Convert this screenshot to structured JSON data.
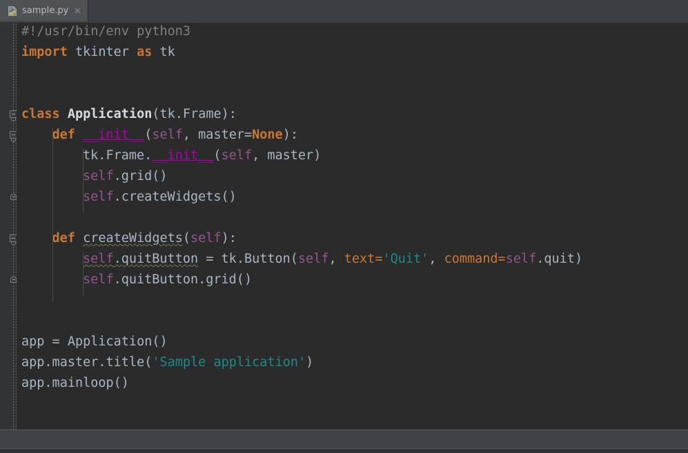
{
  "window": {
    "app_kind": "code-editor",
    "theme": "darcula"
  },
  "tabbar": {
    "tabs": [
      {
        "label": "sample.py",
        "icon": "python-file-icon",
        "close_icon": "close-icon",
        "active": true
      }
    ]
  },
  "editor": {
    "language": "python",
    "colors": {
      "background": "#2b2b2b",
      "gutter": "#313335",
      "default_text": "#a9b7c6",
      "keyword": "#cc7832",
      "comment": "#808080",
      "string": "#1a8c8c",
      "self": "#94558d",
      "magic_method": "#b200b2",
      "class_name": "#d7dbe0",
      "warning_squiggle": "#7a7a52",
      "tab_active": "#4e5254",
      "tab_bar": "#3c3f41",
      "bottom_panel": "#3c4245"
    },
    "lines": [
      {
        "n": 1,
        "indent": 0,
        "tokens": [
          {
            "t": "#!/usr/bin/env python3",
            "c": "comment"
          }
        ]
      },
      {
        "n": 2,
        "indent": 0,
        "tokens": [
          {
            "t": "import",
            "c": "kw"
          },
          {
            "t": " tkinter ",
            "c": "plain"
          },
          {
            "t": "as",
            "c": "kw"
          },
          {
            "t": " tk",
            "c": "plain"
          }
        ]
      },
      {
        "n": 3,
        "indent": 0,
        "tokens": []
      },
      {
        "n": 4,
        "indent": 0,
        "tokens": []
      },
      {
        "n": 5,
        "indent": 0,
        "tokens": [
          {
            "t": "class",
            "c": "kw"
          },
          {
            "t": " ",
            "c": "plain"
          },
          {
            "t": "Application",
            "c": "cls"
          },
          {
            "t": "(tk.Frame):",
            "c": "plain"
          }
        ]
      },
      {
        "n": 6,
        "indent": 1,
        "tokens": [
          {
            "t": "def",
            "c": "kw"
          },
          {
            "t": " ",
            "c": "plain"
          },
          {
            "t": "__init__",
            "c": "magic"
          },
          {
            "t": "(",
            "c": "plain"
          },
          {
            "t": "self",
            "c": "self"
          },
          {
            "t": ", master=",
            "c": "plain"
          },
          {
            "t": "None",
            "c": "kw"
          },
          {
            "t": "):",
            "c": "plain"
          }
        ]
      },
      {
        "n": 7,
        "indent": 2,
        "tokens": [
          {
            "t": "tk.Frame.",
            "c": "plain"
          },
          {
            "t": "__init__",
            "c": "magic"
          },
          {
            "t": "(",
            "c": "plain"
          },
          {
            "t": "self",
            "c": "self"
          },
          {
            "t": ", master)",
            "c": "plain"
          }
        ]
      },
      {
        "n": 8,
        "indent": 2,
        "tokens": [
          {
            "t": "self",
            "c": "self"
          },
          {
            "t": ".grid()",
            "c": "plain"
          }
        ]
      },
      {
        "n": 9,
        "indent": 2,
        "tokens": [
          {
            "t": "self",
            "c": "self"
          },
          {
            "t": ".createWidgets()",
            "c": "plain"
          }
        ]
      },
      {
        "n": 10,
        "indent": 0,
        "tokens": []
      },
      {
        "n": 11,
        "indent": 1,
        "tokens": [
          {
            "t": "def",
            "c": "kw"
          },
          {
            "t": " ",
            "c": "plain"
          },
          {
            "t": "createWidgets",
            "c": "plain-squiggle"
          },
          {
            "t": "(",
            "c": "plain"
          },
          {
            "t": "self",
            "c": "self"
          },
          {
            "t": "):",
            "c": "plain"
          }
        ]
      },
      {
        "n": 12,
        "indent": 2,
        "tokens": [
          {
            "t": "self",
            "c": "self-squiggle"
          },
          {
            "t": ".quitButton",
            "c": "plain-squiggle"
          },
          {
            "t": " = tk.Button(",
            "c": "plain"
          },
          {
            "t": "self",
            "c": "self"
          },
          {
            "t": ", ",
            "c": "plain"
          },
          {
            "t": "text=",
            "c": "kwarg"
          },
          {
            "t": "'Quit'",
            "c": "str"
          },
          {
            "t": ", ",
            "c": "plain"
          },
          {
            "t": "command=",
            "c": "kwarg"
          },
          {
            "t": "self",
            "c": "self"
          },
          {
            "t": ".quit)",
            "c": "plain"
          }
        ]
      },
      {
        "n": 13,
        "indent": 2,
        "tokens": [
          {
            "t": "self",
            "c": "self"
          },
          {
            "t": ".quitButton.grid()",
            "c": "plain"
          }
        ]
      },
      {
        "n": 14,
        "indent": 0,
        "tokens": []
      },
      {
        "n": 15,
        "indent": 0,
        "tokens": []
      },
      {
        "n": 16,
        "indent": 0,
        "tokens": [
          {
            "t": "app = Application()",
            "c": "plain"
          }
        ]
      },
      {
        "n": 17,
        "indent": 0,
        "tokens": [
          {
            "t": "app.master.title(",
            "c": "plain"
          },
          {
            "t": "'Sample application'",
            "c": "str"
          },
          {
            "t": ")",
            "c": "plain"
          }
        ]
      },
      {
        "n": 18,
        "indent": 0,
        "tokens": [
          {
            "t": "app.mainloop()",
            "c": "plain"
          }
        ]
      }
    ],
    "fold_markers": [
      {
        "kind": "fold-open",
        "line": 5
      },
      {
        "kind": "fold-open",
        "line": 6
      },
      {
        "kind": "fold-end",
        "line": 9
      },
      {
        "kind": "fold-open",
        "line": 11
      },
      {
        "kind": "fold-end",
        "line": 13
      }
    ]
  },
  "bottom": {
    "panel": "tool-window-strip",
    "status": ""
  }
}
